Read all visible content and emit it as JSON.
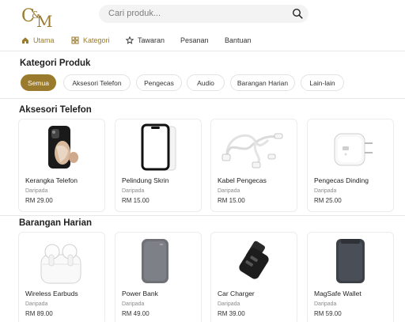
{
  "brand": {
    "logo_text": "C&M",
    "accent_color": "#9a7a2c"
  },
  "search": {
    "placeholder": "Cari produk..."
  },
  "nav": [
    {
      "label": "Utama",
      "icon": "home-icon"
    },
    {
      "label": "Kategori",
      "icon": "grid-icon"
    },
    {
      "label": "Tawaran",
      "icon": "star-icon"
    },
    {
      "label": "Pesanan"
    },
    {
      "label": "Bantuan"
    }
  ],
  "category_section": {
    "title": "Kategori Produk"
  },
  "chips": [
    "Semua",
    "Aksesori Telefon",
    "Pengecas",
    "Audio",
    "Barangan Harian",
    "Lain-lain"
  ],
  "sections": [
    {
      "title": "Aksesori Telefon",
      "products": [
        {
          "name": "Kerangka Telefon",
          "seller": "Daripada",
          "price": "RM 29.00",
          "image_icon": "phone-case-icon"
        },
        {
          "name": "Pelindung Skrin",
          "seller": "Daripada",
          "price": "RM 15.00",
          "image_icon": "screen-protector-icon"
        },
        {
          "name": "Kabel Pengecas",
          "seller": "Daripada",
          "price": "RM 15.00",
          "image_icon": "charging-cable-icon"
        },
        {
          "name": "Pengecas Dinding",
          "seller": "Daripada",
          "price": "RM 25.00",
          "image_icon": "wall-charger-icon"
        }
      ]
    },
    {
      "title": "Barangan Harian",
      "products": [
        {
          "name": "Wireless Earbuds",
          "seller": "Daripada",
          "price": "RM 89.00",
          "image_icon": "earbuds-icon"
        },
        {
          "name": "Power Bank",
          "seller": "Daripada",
          "price": "RM 49.00",
          "image_icon": "power-bank-icon"
        },
        {
          "name": "Car Charger",
          "seller": "Daripada",
          "price": "RM 39.00",
          "image_icon": "car-charger-icon"
        },
        {
          "name": "MagSafe Wallet",
          "seller": "Daripada",
          "price": "RM 59.00",
          "image_icon": "magsafe-wallet-icon"
        }
      ]
    }
  ]
}
